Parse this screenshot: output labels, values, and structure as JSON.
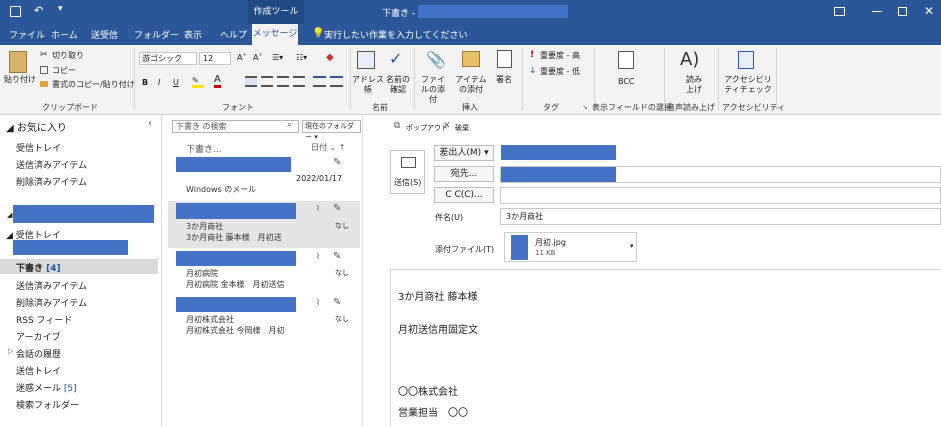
{
  "title_bar": {
    "tool_group": "作成ツール",
    "doc_title": "下書き -"
  },
  "ribbon_tabs": [
    "ファイル",
    "ホーム",
    "送受信",
    "フォルダー",
    "表示",
    "ヘルプ",
    "メッセージ"
  ],
  "tell_me": "実行したい作業を入力してください",
  "clipboard": {
    "paste": "貼り付け",
    "cut": "切り取り",
    "copy": "コピー",
    "format_painter": "書式のコピー/貼り付け",
    "label": "クリップボード"
  },
  "font": {
    "name": "游ゴシック",
    "size": "12",
    "label": "フォント",
    "bold": "B",
    "italic": "I",
    "underline": "U"
  },
  "names": {
    "address_book": "アドレス帳",
    "check_names": "名前の確認",
    "label": "名前"
  },
  "insert": {
    "attach_file": "ファイルの添付",
    "attach_item": "アイテムの添付",
    "signature": "署名",
    "label": "挿入"
  },
  "tags": {
    "high": "重要度 - 高",
    "low": "重要度 - 低",
    "label": "タグ"
  },
  "show_fields": {
    "bcc": "BCC",
    "label": "表示フィールドの選択"
  },
  "voice": {
    "read": "読み上げ",
    "label": "音声読み上げ"
  },
  "accessibility": {
    "check": "アクセシビリティチェック",
    "label": "アクセシビリティ"
  },
  "folders": {
    "favorites": "お気に入り",
    "fav_items": [
      "受信トレイ",
      "送信済みアイテム",
      "削除済みアイテム"
    ],
    "inbox": "受信トレイ",
    "drafts": "下書き",
    "drafts_count": "[4]",
    "sub_items": [
      "送信済みアイテム",
      "削除済みアイテム",
      "RSS フィード",
      "アーカイブ"
    ],
    "history": "会話の履歴",
    "outbox": "送信トレイ",
    "junk": "迷惑メール",
    "junk_count": "[5]",
    "search_folders": "検索フォルダー"
  },
  "message_list": {
    "search_placeholder": "下書き の検索",
    "scope": "現在のフォルダー",
    "folder_title": "下書き...",
    "sort": "日付",
    "items": [
      {
        "line1": "",
        "date": "2022/01/17",
        "line2": "Windows のメール",
        "flag": ""
      },
      {
        "line1": "3か月商社",
        "line2": "3か月商社 藤本様　月初送",
        "flag": "なし"
      },
      {
        "line1": "月初病院",
        "line2": "月初病院 金本様　月初送信",
        "flag": "なし"
      },
      {
        "line1": "月初株式会社",
        "line2": "月初株式会社 今岡様　月初",
        "flag": "なし"
      }
    ]
  },
  "compose": {
    "popout": "ポップアウト",
    "discard": "破棄",
    "send": "送信(S)",
    "from": "差出人(M)",
    "to": "宛先...",
    "cc": "C C(C)...",
    "subject_label": "件名(U)",
    "subject": "3か月商社",
    "attachment_label": "添付ファイル(T)",
    "attachment_name": "月初.jpg",
    "attachment_size": "11 KB",
    "body": [
      "3か月商社 藤本様",
      "月初送信用固定文",
      "",
      "〇〇株式会社",
      "営業担当　〇〇"
    ]
  }
}
